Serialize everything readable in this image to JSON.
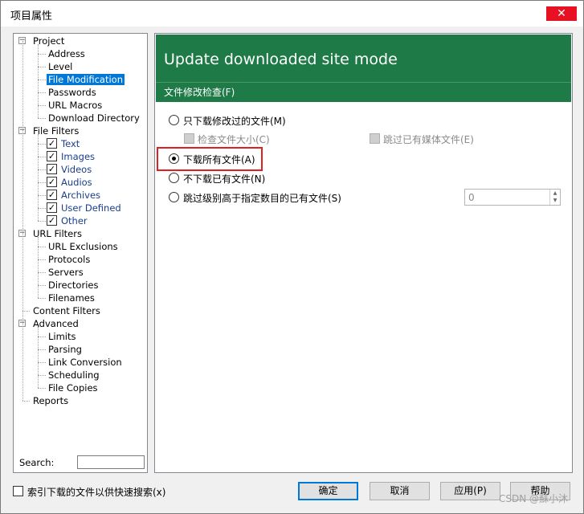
{
  "window": {
    "title": "项目属性",
    "close_glyph": "✕"
  },
  "tree": {
    "nodes": [
      {
        "label": "Project",
        "level": 0,
        "expander": "−"
      },
      {
        "label": "Address",
        "level": 1
      },
      {
        "label": "Level",
        "level": 1
      },
      {
        "label": "File Modification",
        "level": 1,
        "selected": true
      },
      {
        "label": "Passwords",
        "level": 1
      },
      {
        "label": "URL Macros",
        "level": 1
      },
      {
        "label": "Download Directory",
        "level": 1
      },
      {
        "label": "File Filters",
        "level": 0,
        "expander": "−"
      },
      {
        "label": "Text",
        "level": 1,
        "checked": true
      },
      {
        "label": "Images",
        "level": 1,
        "checked": true
      },
      {
        "label": "Videos",
        "level": 1,
        "checked": true
      },
      {
        "label": "Audios",
        "level": 1,
        "checked": true
      },
      {
        "label": "Archives",
        "level": 1,
        "checked": true
      },
      {
        "label": "User Defined",
        "level": 1,
        "checked": true
      },
      {
        "label": "Other",
        "level": 1,
        "checked": true
      },
      {
        "label": "URL Filters",
        "level": 0,
        "expander": "−"
      },
      {
        "label": "URL Exclusions",
        "level": 1
      },
      {
        "label": "Protocols",
        "level": 1
      },
      {
        "label": "Servers",
        "level": 1
      },
      {
        "label": "Directories",
        "level": 1
      },
      {
        "label": "Filenames",
        "level": 1
      },
      {
        "label": "Content Filters",
        "level": 0
      },
      {
        "label": "Advanced",
        "level": 0,
        "expander": "−"
      },
      {
        "label": "Limits",
        "level": 1
      },
      {
        "label": "Parsing",
        "level": 1
      },
      {
        "label": "Link Conversion",
        "level": 1
      },
      {
        "label": "Scheduling",
        "level": 1
      },
      {
        "label": "File Copies",
        "level": 1
      },
      {
        "label": "Reports",
        "level": 0
      }
    ],
    "search_label": "Search:",
    "search_value": ""
  },
  "content": {
    "header_title": "Update downloaded site mode",
    "section_title": "文件修改检查(F)",
    "options": {
      "only_modified": "只下载修改过的文件(M)",
      "check_size": "检查文件大小(C)",
      "skip_media": "跳过已有媒体文件(E)",
      "download_all": "下载所有文件(A)",
      "no_existing": "不下载已有文件(N)",
      "skip_level": "跳过级别高于指定数目的已有文件(S)"
    },
    "selected_option": "download_all",
    "skip_level_value": "0"
  },
  "footer": {
    "index_label": "索引下载的文件以供快速搜索(x)",
    "ok": "确定",
    "cancel": "取消",
    "apply": "应用(P)",
    "help": "帮助"
  },
  "watermark": "CSDN @蘇小沐",
  "colors": {
    "header_green": "#1e7a46",
    "selection_blue": "#0078d7",
    "highlight_red": "#e02020"
  }
}
